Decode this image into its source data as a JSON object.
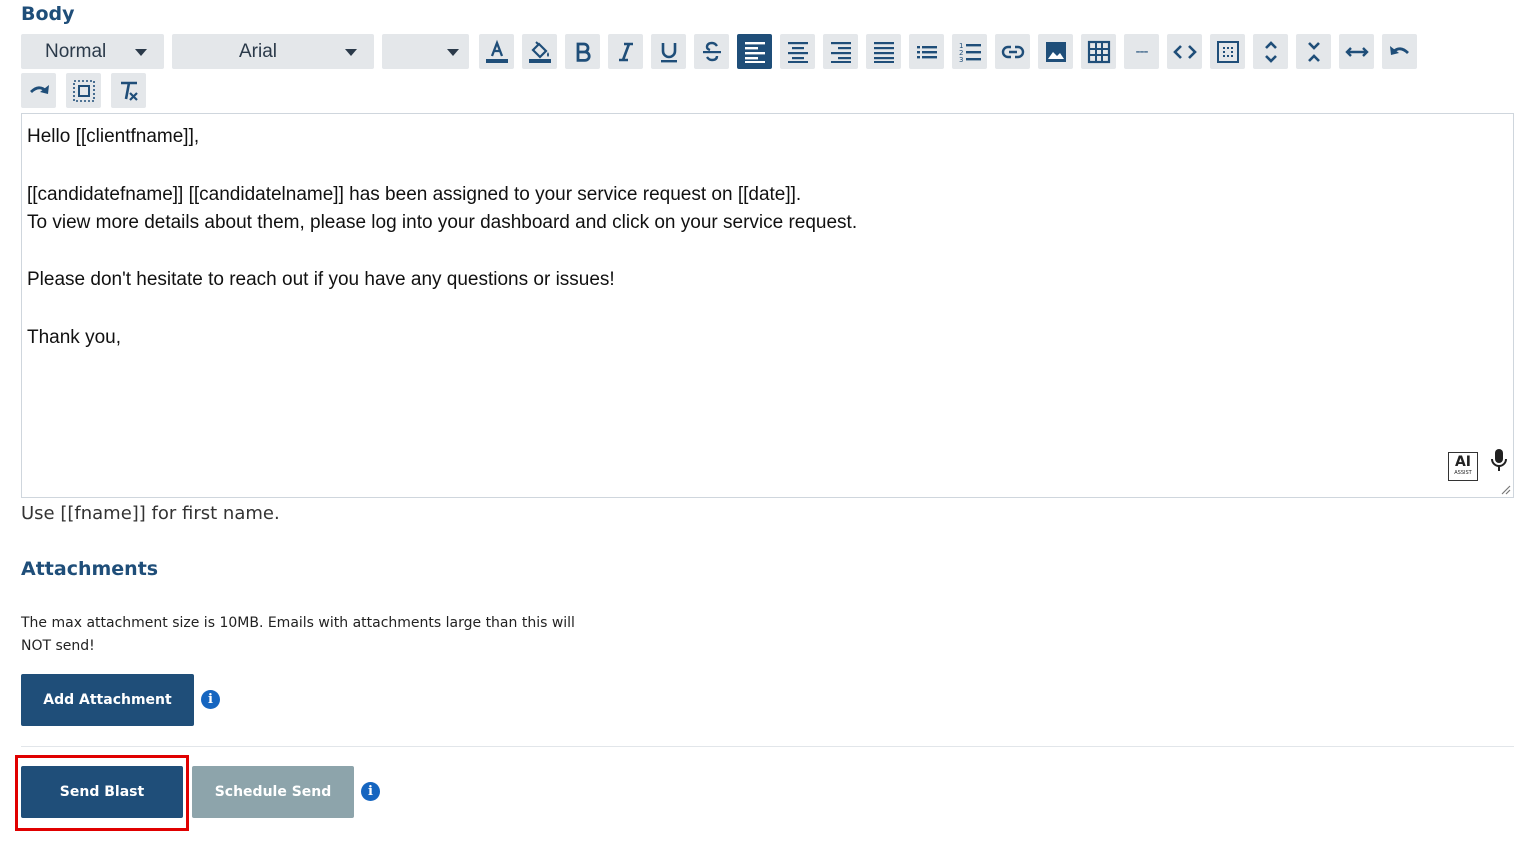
{
  "body_section": {
    "title": "Body"
  },
  "toolbar": {
    "paragraph_style": "Normal",
    "font_family": "Arial",
    "font_size": "",
    "buttons_row1": [
      {
        "name": "font-color-icon"
      },
      {
        "name": "background-color-icon"
      },
      {
        "name": "bold-icon"
      },
      {
        "name": "italic-icon"
      },
      {
        "name": "underline-icon"
      },
      {
        "name": "strikethrough-icon"
      },
      {
        "name": "align-left-icon",
        "active": true
      },
      {
        "name": "align-center-icon"
      },
      {
        "name": "align-right-icon"
      },
      {
        "name": "align-justify-icon"
      },
      {
        "name": "bulleted-list-icon"
      },
      {
        "name": "numbered-list-icon"
      },
      {
        "name": "link-icon"
      },
      {
        "name": "image-icon"
      },
      {
        "name": "table-icon"
      },
      {
        "name": "horizontal-rule-icon"
      },
      {
        "name": "code-view-icon"
      },
      {
        "name": "select-all-icon"
      },
      {
        "name": "expand-icon"
      },
      {
        "name": "collapse-icon"
      },
      {
        "name": "full-width-icon"
      },
      {
        "name": "undo-icon"
      }
    ],
    "buttons_row2": [
      {
        "name": "redo-icon"
      },
      {
        "name": "select-icon"
      },
      {
        "name": "clear-formatting-icon"
      }
    ],
    "horizontal_rule_label": "---"
  },
  "editor": {
    "lines": [
      "Hello [[clientfname]],",
      "[[candidatefname]] [[candidatelname]] has been assigned to your service request on [[date]].",
      "To view more details about them, please log into your dashboard and click on your service request.",
      "Please don't hesitate to reach out if you have any questions or issues!",
      "Thank you,"
    ],
    "ai_badge": {
      "big": "AI",
      "small": "ASSIST"
    }
  },
  "hint": "Use [[fname]] for first name.",
  "attachments": {
    "title": "Attachments",
    "note": "The max attachment size is 10MB. Emails with attachments large than this will NOT send!",
    "add_button": "Add Attachment"
  },
  "actions": {
    "send_blast": "Send Blast",
    "schedule_send": "Schedule Send",
    "info_glyph": "i"
  },
  "colors": {
    "primary": "#1f4e79",
    "disabled": "#8da4ab",
    "info": "#1565c0",
    "highlight": "#e00000"
  }
}
